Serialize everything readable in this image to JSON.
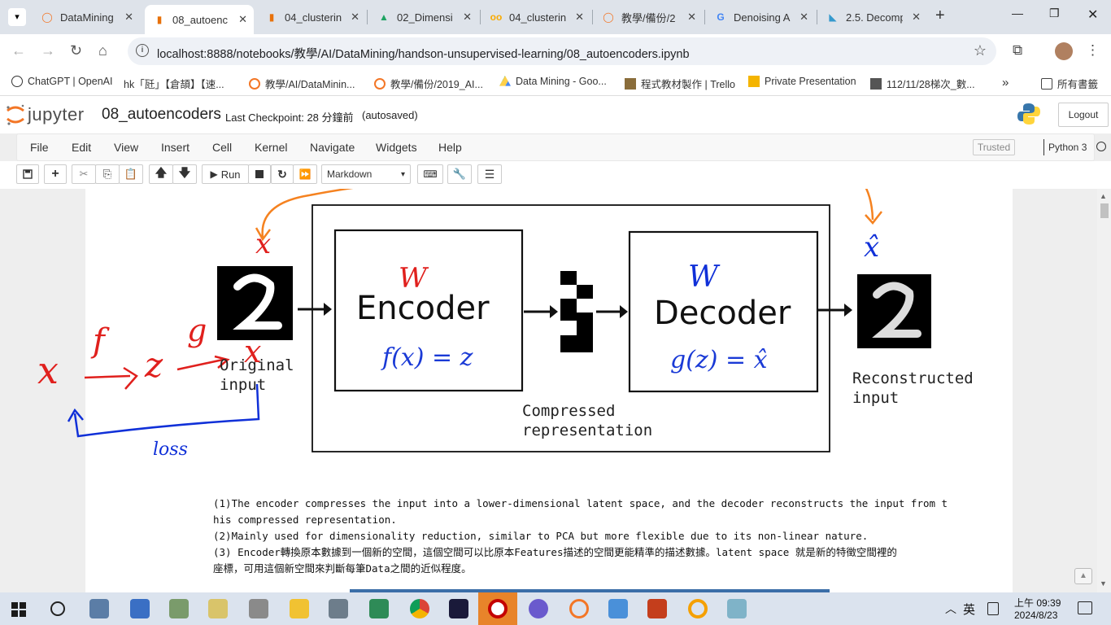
{
  "browser": {
    "tabs": [
      {
        "label": "DataMining",
        "icon": "jupyter-icon",
        "active": false
      },
      {
        "label": "08_autoenc",
        "icon": "notebook-icon",
        "active": true
      },
      {
        "label": "04_clusterin",
        "icon": "notebook-icon",
        "active": false
      },
      {
        "label": "02_Dimensi",
        "icon": "drive-icon",
        "active": false
      },
      {
        "label": "04_clusterin",
        "icon": "colab-icon",
        "active": false
      },
      {
        "label": "教學/備份/2",
        "icon": "jupyter-icon",
        "active": false
      },
      {
        "label": "Denoising A",
        "icon": "google-icon",
        "active": false
      },
      {
        "label": "2.5. Decomp",
        "icon": "sklearn-icon",
        "active": false
      }
    ],
    "url": "localhost:8888/notebooks/教學/AI/DataMining/handson-unsupervised-learning/08_autoencoders.ipynb",
    "bookmarks": [
      "ChatGPT | OpenAI",
      "hk「瓩」【倉頡】【速...",
      "教學/AI/DataMinin...",
      "教學/備份/2019_AI...",
      "Data Mining - Goo...",
      "程式教材製作 | Trello",
      "Private Presentation",
      "112/11/28梯次_數..."
    ],
    "all_bookmarks": "所有書籤"
  },
  "jupyter": {
    "logo_text": "jupyter",
    "notebook_name": "08_autoencoders",
    "checkpoint": "Last Checkpoint: 28 分鐘前",
    "autosaved": "(autosaved)",
    "logout": "Logout",
    "menus": [
      "File",
      "Edit",
      "View",
      "Insert",
      "Cell",
      "Kernel",
      "Navigate",
      "Widgets",
      "Help"
    ],
    "trusted": "Trusted",
    "kernel": "Python 3",
    "run_label": "Run",
    "cell_type": "Markdown"
  },
  "diagram": {
    "encoder": "Encoder",
    "encoder_formula": "f(x) = z",
    "decoder": "Decoder",
    "decoder_formula": "g(z) = x̂",
    "original_input_line1": "Original",
    "original_input_line2": "input",
    "reconstructed_line1": "Reconstructed",
    "reconstructed_line2": "input",
    "compressed_line1": "Compressed",
    "compressed_line2": "representation",
    "annotations": {
      "w1": "W",
      "w2": "W",
      "x_top": "x",
      "x_hat": "x̂",
      "x_left": "x",
      "f": "f",
      "z": "z",
      "g": "g",
      "x_right": "x",
      "loss": "loss"
    }
  },
  "markdown": {
    "line1": "(1)The encoder compresses the input into a lower-dimensional latent space, and the decoder reconstructs the input from t",
    "line2": "his compressed representation.",
    "line3": "(2)Mainly used for dimensionality reduction, similar to PCA but more flexible due to its non-linear nature.",
    "line4": "(3) Encoder轉換原本數據到一個新的空間，這個空間可以比原本Features描述的空間更能精準的描述數據。latent space 就是新的特徵空間裡的",
    "line5": "座標，可用這個新空間來判斷每筆Data之間的近似程度。"
  },
  "taskbar": {
    "ime": "英",
    "time": "上午 09:39",
    "date": "2024/8/23"
  }
}
